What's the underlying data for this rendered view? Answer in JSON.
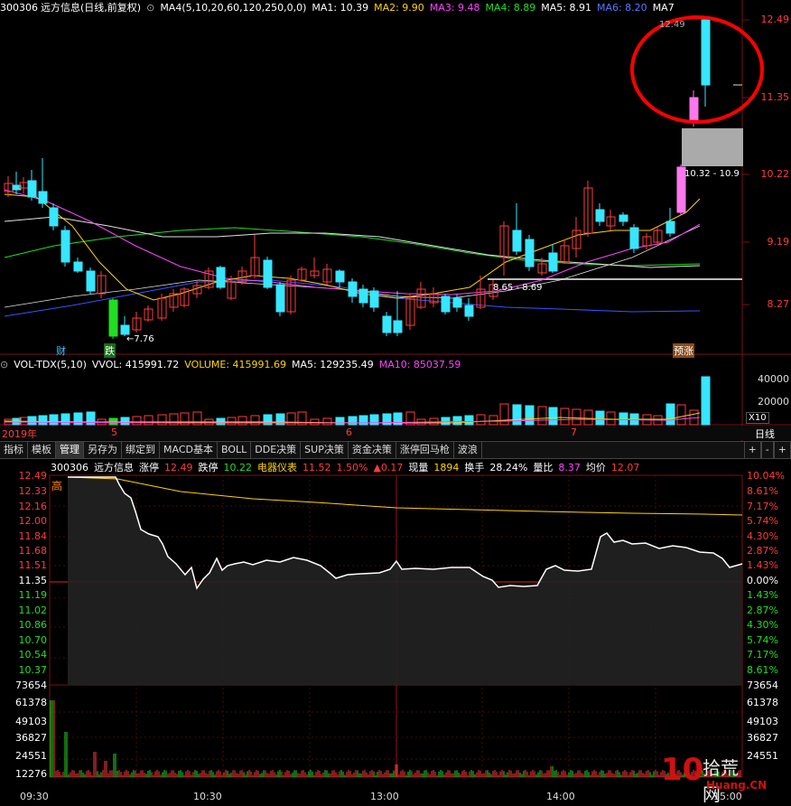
{
  "daily_header": {
    "code": "300306",
    "name": "远方信息",
    "mode": "(日线,前复权)",
    "ma_indicator": "MA4(5,10,20,60,120,250,0,0)",
    "ma1": "MA1: 10.39",
    "ma2": "MA2: 9.90",
    "ma3": "MA3: 9.48",
    "ma4": "MA4: 8.89",
    "ma5": "MA5: 8.91",
    "ma6": "MA6: 8.20",
    "ma7": "MA7"
  },
  "daily_scale": [
    "12.49",
    "11.35",
    "10.22",
    "9.19",
    "8.27"
  ],
  "daily_annotations": {
    "high_label": "12.49",
    "low_label": "7.76",
    "range1": "10.32 - 10.9",
    "range2": "8.65 - 8.69",
    "tag_cai": "财",
    "tag_die": "跌",
    "tag_yuzhang": "预涨"
  },
  "volume_header": {
    "name": "VOL-TDX(5,10)",
    "vvol": "VVOL: 415991.72",
    "volume": "VOLUME: 415991.69",
    "ma5": "MA5: 129235.49",
    "ma10": "MA10: 85037.59"
  },
  "volume_scale": [
    "40000",
    "20000"
  ],
  "volume_unit": "X10",
  "date_axis": {
    "year": "2019年",
    "m5": "5",
    "m6": "6",
    "m7": "7"
  },
  "period_label": "日线",
  "tabs": [
    "指标",
    "模板",
    "管理",
    "另存为",
    "绑定到",
    "MACD基本",
    "BOLL",
    "DDE决策",
    "SUP决策",
    "资金决策",
    "涨停回马枪",
    "波浪"
  ],
  "tab_controls": [
    "+",
    "-",
    "+"
  ],
  "intraday_header": {
    "code": "300306",
    "name": "远方信息",
    "limit_up_label": "涨停",
    "limit_up": "12.49",
    "limit_down_label": "跌停",
    "limit_down": "10.22",
    "tool": "电器仪表",
    "price": "11.52",
    "pct": "1.50%",
    "change": "▲0.17",
    "volume_label": "现量",
    "volume": "1894",
    "turnover_label": "换手",
    "turnover": "28.24%",
    "ratio_label": "量比",
    "ratio": "8.37",
    "avg_label": "均价",
    "avg": "12.07"
  },
  "intraday_price_left": [
    "12.49",
    "12.33",
    "12.16",
    "12.00",
    "11.84",
    "11.68",
    "11.51",
    "11.35",
    "11.19",
    "11.02",
    "10.86",
    "10.70",
    "10.54",
    "10.37"
  ],
  "intraday_pct_right": [
    "10.04%",
    "8.61%",
    "7.17%",
    "5.74%",
    "4.30%",
    "2.87%",
    "1.43%",
    "0.00%",
    "1.43%",
    "2.87%",
    "4.30%",
    "5.74%",
    "7.17%",
    "8.61%"
  ],
  "intraday_vol_left": [
    "73654",
    "61378",
    "49103",
    "36827",
    "24551",
    "12276"
  ],
  "intraday_vol_right": [
    "73654",
    "61378",
    "49103",
    "36827",
    "24551"
  ],
  "high_tag": "高",
  "time_axis": [
    "09:30",
    "10:30",
    "13:00",
    "14:00",
    "15:00"
  ],
  "watermark": {
    "num": "10",
    "cn": "拾荒网",
    "url": "Huang.CN"
  },
  "colors": {
    "up": "#ff3b3b",
    "down": "#37e6ff",
    "highlight": "#ff0000",
    "limit": "#ff77ee"
  }
}
